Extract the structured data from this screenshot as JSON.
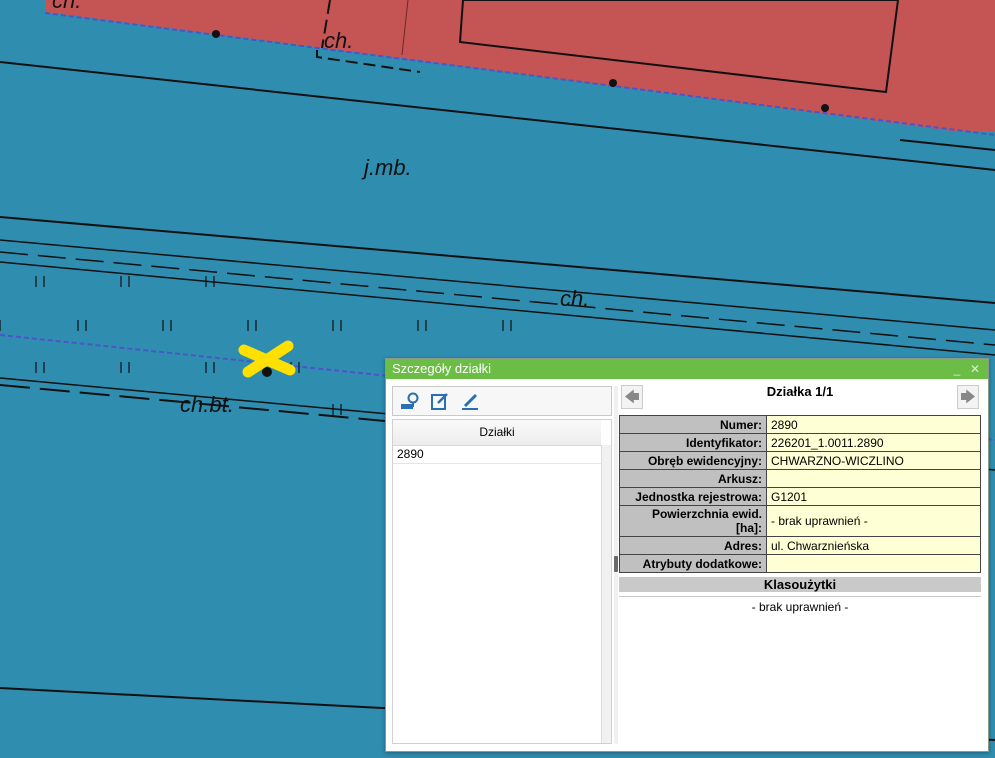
{
  "map": {
    "labels": {
      "ch_top_left": "ch.",
      "ch_top": "ch.",
      "jmb": "j.mb.",
      "ch_right": "ch.",
      "chbt": "ch.bt."
    }
  },
  "dialog": {
    "title": "Szczegóły działki",
    "controls": {
      "minimize": "_",
      "close": "✕"
    },
    "toolbar": {
      "icons": [
        "locate-parcel-icon",
        "edit-note-icon",
        "pencil-icon"
      ]
    },
    "list": {
      "header": "Działki",
      "items": [
        "2890"
      ]
    },
    "nav": {
      "title": "Działka 1/1",
      "prev": "🡄",
      "next": "🡆"
    },
    "details": [
      {
        "label": "Numer:",
        "value": "2890"
      },
      {
        "label": "Identyfikator:",
        "value": "226201_1.0011.2890"
      },
      {
        "label": "Obręb ewidencyjny:",
        "value": "CHWARZNO-WICZLINO"
      },
      {
        "label": "Arkusz:",
        "value": ""
      },
      {
        "label": "Jednostka rejestrowa:",
        "value": "G1201"
      },
      {
        "label": "Powierzchnia ewid. [ha]:",
        "value": "- brak uprawnień -"
      },
      {
        "label": "Adres:",
        "value": "ul. Chwarznieńska"
      },
      {
        "label": "Atrybuty dodatkowe:",
        "value": ""
      }
    ],
    "klasouzytki": {
      "header": "Klasoużytki",
      "body": "- brak uprawnień -"
    },
    "colors": {
      "titlebar": "#6cbd45",
      "map_water": "#2f8db0",
      "map_building": "#c55555",
      "value_bg": "#ffffd5",
      "label_bg": "#c0c0c0",
      "marker": "#ffe000"
    }
  }
}
